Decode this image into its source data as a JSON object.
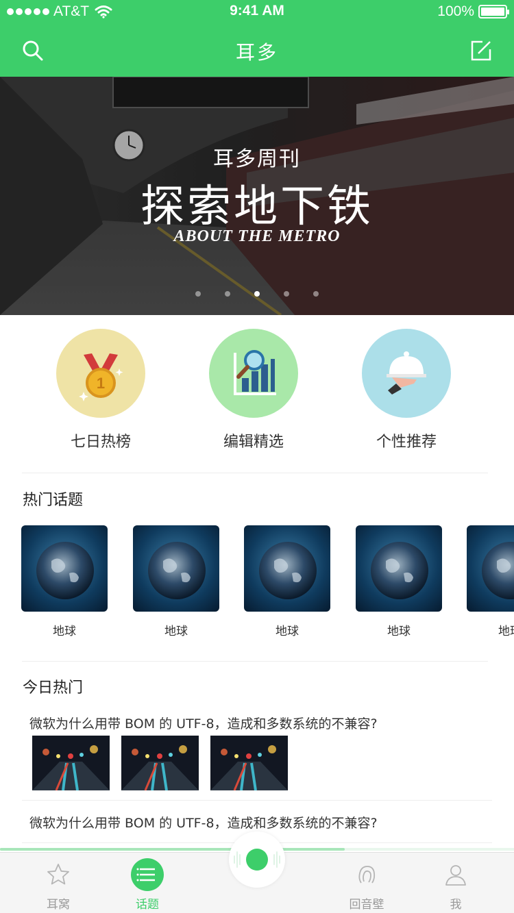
{
  "status_bar": {
    "carrier": "AT&T",
    "time": "9:41 AM",
    "battery": "100%",
    "signal_icon": "signal-dots-icon",
    "wifi_icon": "wifi-icon"
  },
  "nav": {
    "title": "耳多",
    "left_icon": "search-icon",
    "right_icon": "compose-icon"
  },
  "banner": {
    "kicker": "耳多周刊",
    "headline": "探索地下铁",
    "subtitle": "ABOUT THE METRO",
    "page_count": 5,
    "active_page": 3
  },
  "categories": [
    {
      "label": "七日热榜",
      "icon": "medal-icon",
      "color": "#efe3a6"
    },
    {
      "label": "编辑精选",
      "icon": "chart-magnifier-icon",
      "color": "#a9e8a9"
    },
    {
      "label": "个性推荐",
      "icon": "serving-cloche-icon",
      "color": "#acdfe9"
    }
  ],
  "hot_topics": {
    "title": "热门话题",
    "items": [
      {
        "label": "地球"
      },
      {
        "label": "地球"
      },
      {
        "label": "地球"
      },
      {
        "label": "地球"
      },
      {
        "label": "地球"
      }
    ]
  },
  "today_hot": {
    "title": "今日热门",
    "articles": [
      {
        "title": "微软为什么用带 BOM 的 UTF-8，造成和多数系统的不兼容?"
      },
      {
        "title": "微软为什么用带 BOM 的 UTF-8，造成和多数系统的不兼容?"
      }
    ]
  },
  "player": {
    "progress": 0.67,
    "icon": "voice-play-icon"
  },
  "tabs": [
    {
      "label": "耳窝",
      "icon": "star-icon",
      "active": false
    },
    {
      "label": "话题",
      "icon": "list-icon",
      "active": true
    },
    {
      "label": "回音壁",
      "icon": "echo-people-icon",
      "active": false
    },
    {
      "label": "我",
      "icon": "person-icon",
      "active": false
    }
  ],
  "colors": {
    "brand_green": "#3dce6a",
    "inactive_gray": "#9a9a9a"
  }
}
